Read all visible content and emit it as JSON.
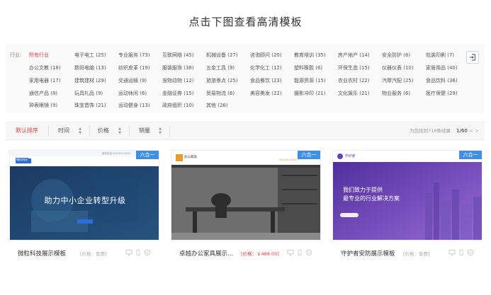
{
  "headline": "点击下图查看高清模板",
  "filter": {
    "label": "行业:",
    "categories": [
      "所有行业",
      "电子电工 (25)",
      "专业服务 (73)",
      "互联网络 (45)",
      "机械设备 (27)",
      "咨询顾问 (20)",
      "教育培训 (35)",
      "房产地产 (14)",
      "安全防护 (6)",
      "包装印刷 (7)",
      "办公文教 (18)",
      "数码电脑 (13)",
      "纺织皮革 (19)",
      "服装服饰 (38)",
      "五金工具 (9)",
      "化学化工 (12)",
      "塑料橡胶 (6)",
      "环保生态 (15)",
      "仪器仪表 (10)",
      "家居用品 (40)",
      "家用电器 (17)",
      "建筑建材 (29)",
      "交通运输 (9)",
      "宠物动物 (12)",
      "旅游景点 (25)",
      "食品餐饮 (23)",
      "能源资源 (15)",
      "农业农村 (22)",
      "汽摩汽配 (25)",
      "食品饮料 (36)",
      "通信产品 (8)",
      "玩具礼品 (9)",
      "运动休闲 (6)",
      "金融证券 (15)",
      "贸易物流 (6)",
      "美容美发 (22)",
      "摄影冲印 (21)",
      "文化娱乐 (21)",
      "物业服务 (6)",
      "医疗保健 (29)",
      "钟表眼镜 (9)",
      "珠宝首饰 (21)",
      "运动健身 (13)",
      "政府组织 (10)",
      "其他 (26)"
    ]
  },
  "sort": {
    "default_label": "默认排序",
    "time_label": "时间",
    "price_label": "价格",
    "sales_label": "销量",
    "results_text": "为您找到718条结果",
    "page_indicator": "1/60",
    "prev": "<",
    "next": ">"
  },
  "cards": [
    {
      "badge": "六合一",
      "title": "微粒科技展示模板",
      "price": "[价格：免费]",
      "slogan": "助力中小企业转型升级",
      "logo": "微粒科技",
      "phone": "服务热线 400-000-0000"
    },
    {
      "badge": "六合一",
      "title": "卓越办公家具展示...",
      "price": "[价格：￥488.00]",
      "logo": "办公家具",
      "phone": "400-000-0000"
    },
    {
      "badge": "六合一",
      "title": "守护者安防展示模板",
      "price": "[价格：免费]",
      "logo": "守护者",
      "slogan1": "我们致力于提供",
      "slogan2": "最专业的行业解决方案"
    }
  ],
  "colors": {
    "accent_red": "#e4393c",
    "badge_blue": "#3d8fe8"
  }
}
